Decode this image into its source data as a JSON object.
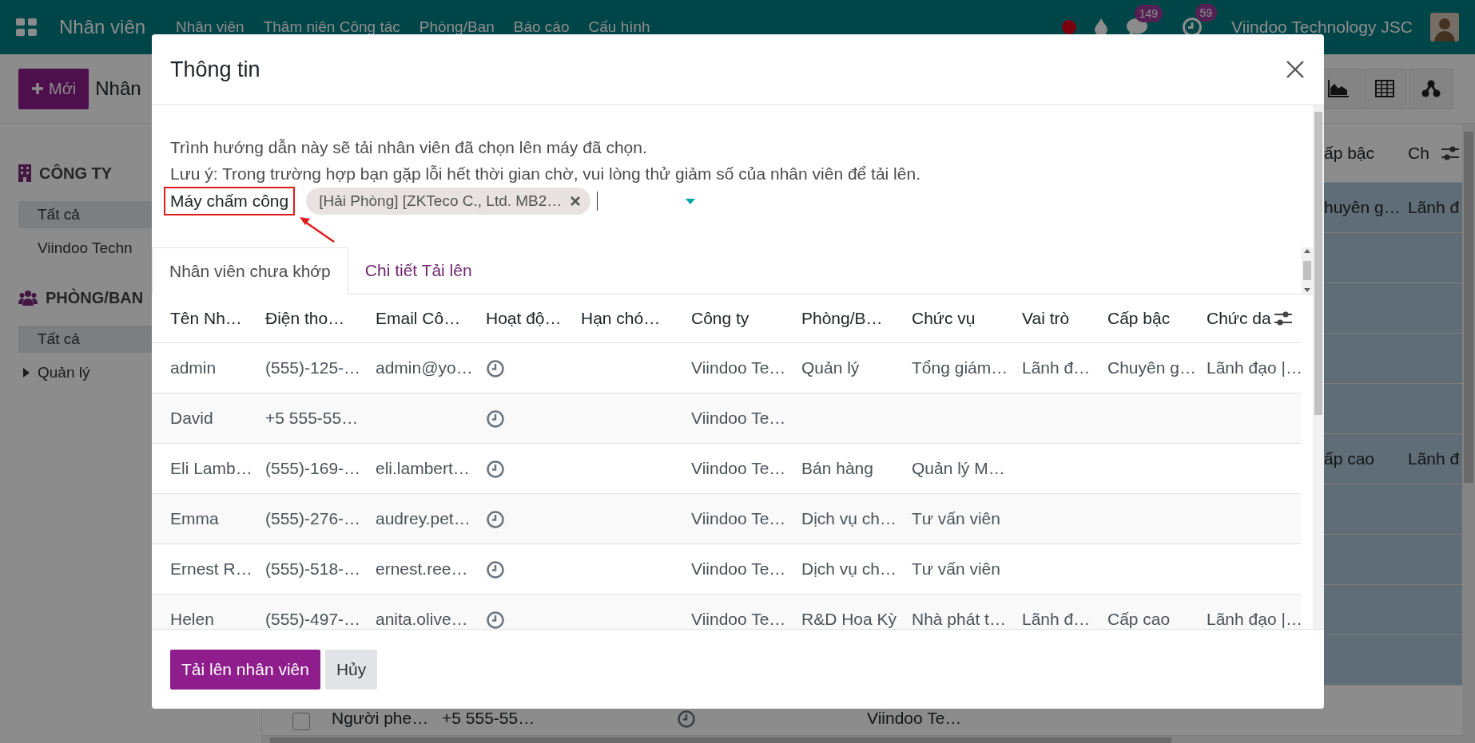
{
  "navbar": {
    "app_title": "Nhân viên",
    "menu": [
      "Nhân viên",
      "Thâm niên Công tác",
      "Phòng/Ban",
      "Báo cáo",
      "Cấu hình"
    ],
    "chat_count": "149",
    "activity_count": "59",
    "company": "Viindoo Technology JSC"
  },
  "control_panel": {
    "new_button": "Mới",
    "breadcrumb": "Nhân",
    "views": [
      {
        "kind": "graph"
      },
      {
        "kind": "pivot"
      },
      {
        "kind": "hierarchy"
      }
    ]
  },
  "sidebar": {
    "sections": [
      {
        "kind": "company",
        "title": "CÔNG TY",
        "items": [
          {
            "label": "Tất cả",
            "selected": true,
            "expandable": false
          },
          {
            "label": "Viindoo Techn",
            "selected": false,
            "expandable": false
          }
        ]
      },
      {
        "kind": "department",
        "title": "PHÒNG/BAN",
        "items": [
          {
            "label": "Tất cả",
            "selected": true,
            "expandable": false
          },
          {
            "label": "Quản lý",
            "selected": false,
            "expandable": true
          }
        ]
      }
    ]
  },
  "background_list": {
    "headers": {
      "grade": "ấp bậc",
      "title": "Ch"
    },
    "rows": [
      {
        "selected": true,
        "grade": "huyên g…",
        "title": "Lãnh đ"
      },
      {
        "selected": true
      },
      {
        "selected": true
      },
      {
        "selected": true
      },
      {
        "selected": true
      },
      {
        "selected": true,
        "grade": "ấp cao",
        "title": "Lãnh đ"
      },
      {
        "selected": true
      },
      {
        "selected": true
      },
      {
        "selected": true
      },
      {
        "selected": true
      },
      {
        "selected": false,
        "name": "Người phe…",
        "phone": "+5 555-55…",
        "activity": true,
        "company": "Viindoo Te…"
      }
    ]
  },
  "dialog": {
    "title": "Thông tin",
    "intro": [
      "Trình hướng dẫn này sẽ tải nhân viên đã chọn lên máy đã chọn.",
      "Lưu ý: Trong trường hợp bạn gặp lỗi hết thời gian chờ, vui lòng thử giảm số của nhân viên để tải lên."
    ],
    "field": {
      "label": "Máy chấm công",
      "highlighted": true,
      "tags": [
        "[Hải Phòng] [ZKTeco C., Ltd. MB2…"
      ]
    },
    "tabs": [
      {
        "label": "Nhân viên chưa khớp",
        "selected": true
      },
      {
        "label": "Chi tiết Tải lên",
        "selected": false
      }
    ],
    "table": {
      "columns": [
        "Tên Nh…",
        "Điện tho…",
        "Email Cô…",
        "Hoạt độ…",
        "Hạn chó…",
        "Công ty",
        "Phòng/B…",
        "Chức vụ",
        "Vai trò",
        "Cấp bậc",
        "Chức da"
      ],
      "rows": [
        {
          "name": "admin",
          "phone": "(555)-125-…",
          "email": "admin@yo…",
          "activity": true,
          "company": "Viindoo Te…",
          "department": "Quản lý",
          "job": "Tổng giám…",
          "role": "Lãnh đ…",
          "grade": "Chuyên g…",
          "title": "Lãnh đạo |…"
        },
        {
          "name": "David",
          "phone": "+5 555-55…",
          "activity": true,
          "company": "Viindoo Te…"
        },
        {
          "name": "Eli Lamb…",
          "phone": "(555)-169-…",
          "email": "eli.lambert…",
          "activity": true,
          "company": "Viindoo Te…",
          "department": "Bán hàng",
          "job": "Quản lý M…"
        },
        {
          "name": "Emma",
          "phone": "(555)-276-…",
          "email": "audrey.pet…",
          "activity": true,
          "company": "Viindoo Te…",
          "department": "Dịch vụ ch…",
          "job": "Tư vấn viên"
        },
        {
          "name": "Ernest R…",
          "phone": "(555)-518-…",
          "email": "ernest.ree…",
          "activity": true,
          "company": "Viindoo Te…",
          "department": "Dịch vụ ch…",
          "job": "Tư vấn viên"
        },
        {
          "name": "Helen",
          "phone": "(555)-497-…",
          "email": "anita.olive…",
          "activity": true,
          "company": "Viindoo Te…",
          "department": "R&D Hoa Kỳ",
          "job": "Nhà phát t…",
          "role": "Lãnh đ…",
          "grade": "Cấp cao",
          "title": "Lãnh đạo |…"
        }
      ]
    },
    "buttons": [
      {
        "label": "Tải lên nhân viên",
        "kind": "primary"
      },
      {
        "label": "Hủy",
        "kind": "secondary"
      }
    ]
  }
}
